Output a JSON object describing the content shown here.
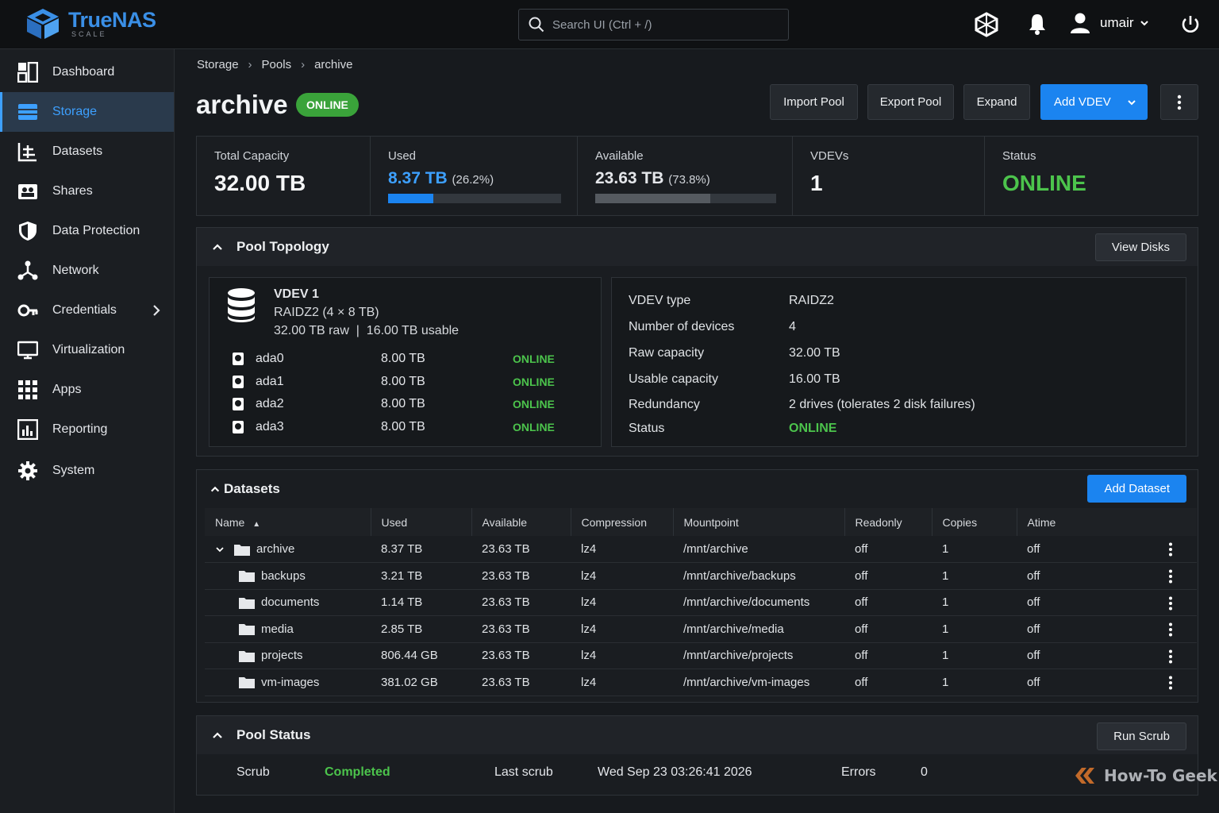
{
  "app": {
    "logo_name": "TrueNAS",
    "logo_sub": "SCALE",
    "search_placeholder": "Search UI (Ctrl + /)",
    "user": "umair",
    "accent": "#1b84f0",
    "online_color": "#4cc44c"
  },
  "sidebar": {
    "items": [
      {
        "label": "Dashboard",
        "icon": "dashboard-icon"
      },
      {
        "label": "Storage",
        "icon": "storage-icon",
        "active": true
      },
      {
        "label": "Datasets",
        "icon": "datasets-icon"
      },
      {
        "label": "Shares",
        "icon": "shares-icon"
      },
      {
        "label": "Data Protection",
        "icon": "shield-icon"
      },
      {
        "label": "Network",
        "icon": "network-icon"
      },
      {
        "label": "Credentials",
        "icon": "key-icon",
        "has_submenu": true
      },
      {
        "label": "Virtualization",
        "icon": "monitor-icon"
      },
      {
        "label": "Apps",
        "icon": "apps-grid-icon"
      },
      {
        "label": "Reporting",
        "icon": "reporting-icon"
      },
      {
        "label": "System",
        "icon": "gear-icon"
      }
    ]
  },
  "breadcrumb": [
    "Storage",
    "Pools",
    "archive"
  ],
  "pool": {
    "name": "archive",
    "status_badge": "ONLINE"
  },
  "actions": {
    "import": "Import Pool",
    "export": "Export Pool",
    "expand": "Expand",
    "add_vdev": "Add VDEV"
  },
  "stats": {
    "total_label": "Total Capacity",
    "total_value": "32.00 TB",
    "used_label": "Used",
    "used_value": "8.37 TB",
    "used_pct": "(26.2%)",
    "used_fraction": 0.262,
    "avail_label": "Available",
    "avail_value": "23.63 TB",
    "avail_pct": "(73.8%)",
    "avail_fraction": 0.738,
    "vdevs_label": "VDEVs",
    "vdevs_value": "1",
    "status_label": "Status",
    "status_value": "ONLINE"
  },
  "topology": {
    "title": "Pool Topology",
    "view_disks": "View Disks",
    "vdev_title": "VDEV 1",
    "vdev_layout": "RAIDZ2 (4 × 8 TB)",
    "vdev_capacity": "32.00 TB raw  |  16.00 TB usable",
    "disks": [
      {
        "name": "ada0",
        "size": "8.00 TB",
        "status": "ONLINE"
      },
      {
        "name": "ada1",
        "size": "8.00 TB",
        "status": "ONLINE"
      },
      {
        "name": "ada2",
        "size": "8.00 TB",
        "status": "ONLINE"
      },
      {
        "name": "ada3",
        "size": "8.00 TB",
        "status": "ONLINE"
      }
    ],
    "info": [
      {
        "k": "VDEV type",
        "v": "RAIDZ2"
      },
      {
        "k": "Number of devices",
        "v": "4"
      },
      {
        "k": "Raw capacity",
        "v": "32.00 TB"
      },
      {
        "k": "Usable capacity",
        "v": "16.00 TB"
      },
      {
        "k": "Redundancy",
        "v": "2 drives (tolerates 2 disk failures)"
      },
      {
        "k": "Status",
        "v": "ONLINE"
      }
    ]
  },
  "datasets": {
    "title": "Datasets",
    "add_button": "Add Dataset",
    "columns": [
      "Name",
      "Used",
      "Available",
      "Compression",
      "Mountpoint",
      "Readonly",
      "Copies",
      "Atime"
    ],
    "rows": [
      {
        "name": "archive",
        "used": "8.37 TB",
        "available": "23.63 TB",
        "compression": "lz4",
        "mountpoint": "/mnt/archive",
        "readonly": "off",
        "copies": "1",
        "atime": "off"
      },
      {
        "name": "backups",
        "used": "3.21 TB",
        "available": "23.63 TB",
        "compression": "lz4",
        "mountpoint": "/mnt/archive/backups",
        "readonly": "off",
        "copies": "1",
        "atime": "off"
      },
      {
        "name": "documents",
        "used": "1.14 TB",
        "available": "23.63 TB",
        "compression": "lz4",
        "mountpoint": "/mnt/archive/documents",
        "readonly": "off",
        "copies": "1",
        "atime": "off"
      },
      {
        "name": "media",
        "used": "2.85 TB",
        "available": "23.63 TB",
        "compression": "lz4",
        "mountpoint": "/mnt/archive/media",
        "readonly": "off",
        "copies": "1",
        "atime": "off"
      },
      {
        "name": "projects",
        "used": "806.44 GB",
        "available": "23.63 TB",
        "compression": "lz4",
        "mountpoint": "/mnt/archive/projects",
        "readonly": "off",
        "copies": "1",
        "atime": "off"
      },
      {
        "name": "vm-images",
        "used": "381.02 GB",
        "available": "23.63 TB",
        "compression": "lz4",
        "mountpoint": "/mnt/archive/vm-images",
        "readonly": "off",
        "copies": "1",
        "atime": "off"
      }
    ]
  },
  "pool_status": {
    "title": "Pool Status",
    "run_scrub": "Run Scrub",
    "scrub_label": "Scrub",
    "scrub_value": "Completed",
    "last_scrub_label": "Last scrub",
    "last_scrub_value": "Wed Sep 23 03:26:41 2026",
    "errors_label": "Errors",
    "errors_value": "0"
  },
  "watermark": "How-To Geek"
}
